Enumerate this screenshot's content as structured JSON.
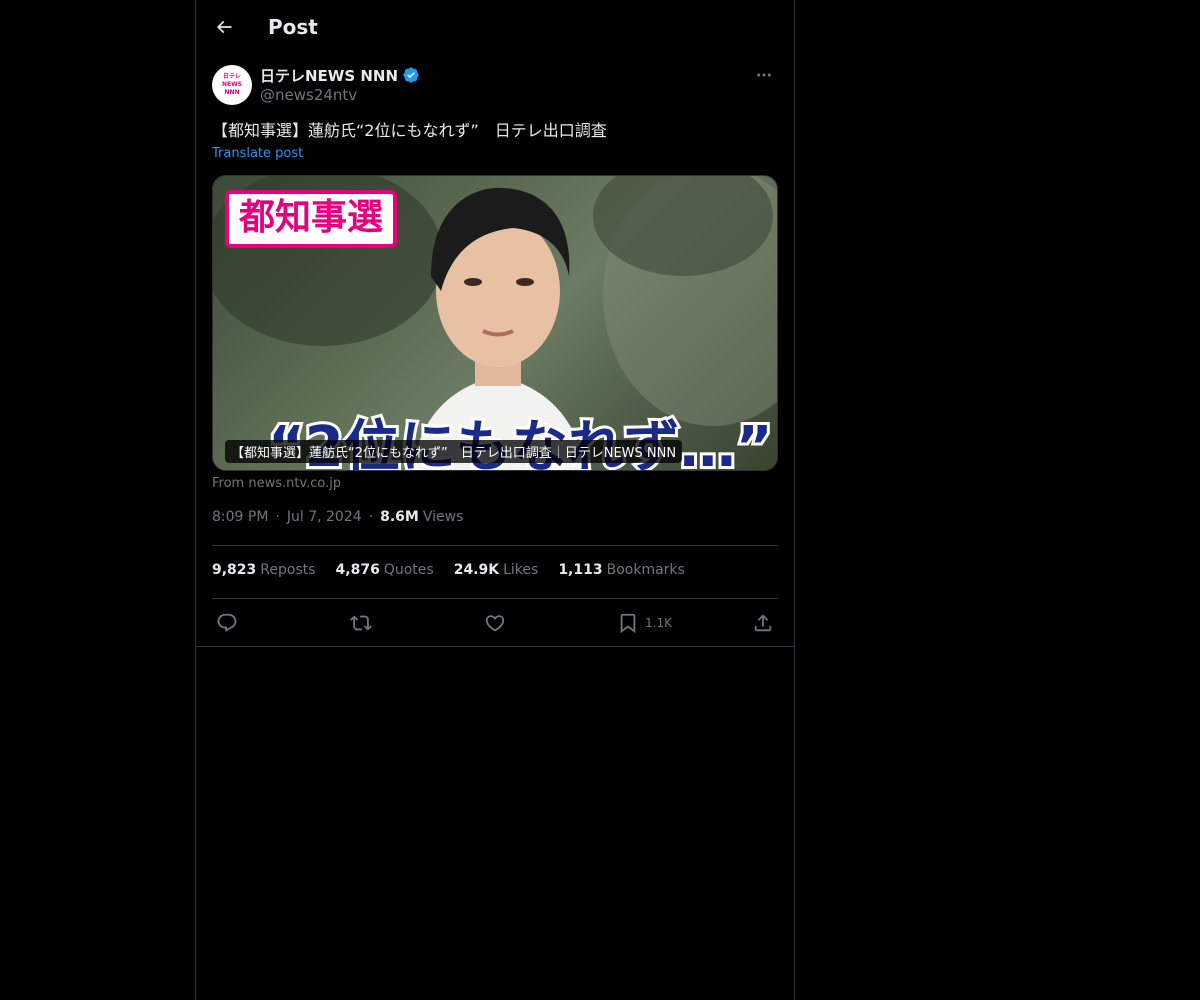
{
  "header": {
    "title": "Post",
    "back_icon": "arrow-left-icon"
  },
  "author": {
    "display_name": "日テレNEWS NNN",
    "handle": "@news24ntv",
    "verified": true,
    "verified_color": "#1d9bf0",
    "avatar_logo_lines": [
      "日テレ",
      "NEWS",
      "NNN"
    ]
  },
  "post": {
    "text": "【都知事選】蓮舫氏“2位にもなれず”　日テレ出口調査",
    "translate_label": "Translate post"
  },
  "media": {
    "overlay_tag": "都知事選",
    "overlay_caption": "“2位にもなれず…”",
    "card_title": "【都知事選】蓮舫氏“2位にもなれず”　日テレ出口調査｜日テレNEWS NNN",
    "source": "From news.ntv.co.jp"
  },
  "meta": {
    "time": "8:09 PM",
    "date": "Jul 7, 2024",
    "views_count": "8.6M",
    "views_label": "Views"
  },
  "stats": {
    "reposts_count": "9,823",
    "reposts_label": "Reposts",
    "quotes_count": "4,876",
    "quotes_label": "Quotes",
    "likes_count": "24.9K",
    "likes_label": "Likes",
    "bookmarks_count": "1,113",
    "bookmarks_label": "Bookmarks"
  },
  "actions": {
    "reply_icon": "reply-icon",
    "repost_icon": "repost-icon",
    "like_icon": "heart-icon",
    "bookmark_icon": "bookmark-icon",
    "bookmark_count": "1.1K",
    "share_icon": "share-icon"
  },
  "colors": {
    "background": "#000000",
    "text_primary": "#e7e9ea",
    "text_secondary": "#71767b",
    "accent": "#1d9bf0",
    "border": "#2f3336",
    "brand_pink": "#e6007e"
  }
}
